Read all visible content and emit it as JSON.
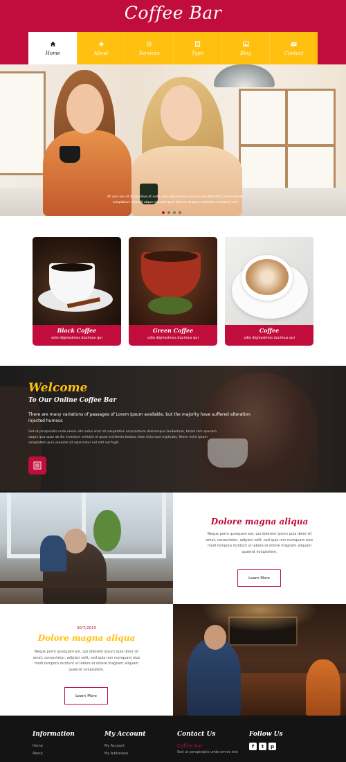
{
  "site": {
    "logo": "Coffee Bar"
  },
  "nav": {
    "items": [
      {
        "label": "Home",
        "icon": "home-icon"
      },
      {
        "label": "About",
        "icon": "star-icon"
      },
      {
        "label": "Services",
        "icon": "gear-icon"
      },
      {
        "label": "Typo",
        "icon": "document-icon"
      },
      {
        "label": "Blog",
        "icon": "image-icon"
      },
      {
        "label": "Contact",
        "icon": "mail-icon"
      }
    ],
    "active": "Home"
  },
  "hero": {
    "caption_line1": "At vero eos et accusamus et iusto odio dignissimos ducimus qui blanditiis praesentium",
    "caption_line2": "voluptatum deleniti atque corrupti quos dolores et quas molestias excepturi sint"
  },
  "products": [
    {
      "title": "Black Coffee",
      "subtitle": "odio dignissimos ducimus qui"
    },
    {
      "title": "Green Coffee",
      "subtitle": "odio dignissimos ducimus qui"
    },
    {
      "title": "Coffee",
      "subtitle": "odio dignissimos ducimus qui"
    }
  ],
  "welcome": {
    "title": "Welcome",
    "subtitle": "To Our Online Coffee Bar",
    "lead": "There are many variations of passages of Lorem Ipsum available, but the majority have suffered alteration injected humour.",
    "body": "Sed ut perspiciatis unde omnis iste natus error sit voluptatem accusantium doloremque laudantium, totam rem aperiam, eaque ipsa quae ab illo inventore veritatis et quasi architecto beatae vitae dicta sunt explicabo. Nemo enim ipsam voluptatem quia voluptas sit aspernatur aut odit aut fugit."
  },
  "block1": {
    "title": "Dolore magna aliqua",
    "text": "Neque porro quisquam est, qui dolorem ipsum quia dolor sit amet, consectetur, adipisci velit, sed quia non numquam eius modi tempora incidunt ut labore et dolore magnam aliquam quaerat voluptatem.",
    "button": "Learn More"
  },
  "block2": {
    "date": "30/7/2015",
    "title": "Dolore magna aliqua",
    "text": "Neque porro quisquam est, qui dolorem ipsum quia dolor sit amet, consectetur, adipisci velit, sed quia non numquam eius modi tempora incidunt ut labore et dolore magnam aliquam quaerat voluptatem.",
    "button": "Learn More"
  },
  "footer": {
    "information": {
      "heading": "Information",
      "links": [
        "Home",
        "About"
      ]
    },
    "account": {
      "heading": "My Account",
      "links": [
        "My Account",
        "My Addresses"
      ]
    },
    "contact": {
      "heading": "Contact Us",
      "name": "Coffee-bar",
      "text": "Sed ut perspiciatis unde omnis iste"
    },
    "follow": {
      "heading": "Follow Us",
      "icons": [
        "f",
        "t",
        "p"
      ]
    }
  },
  "colors": {
    "brand": "#c10d3c",
    "accent": "#ffc00f",
    "footer": "#141414"
  }
}
